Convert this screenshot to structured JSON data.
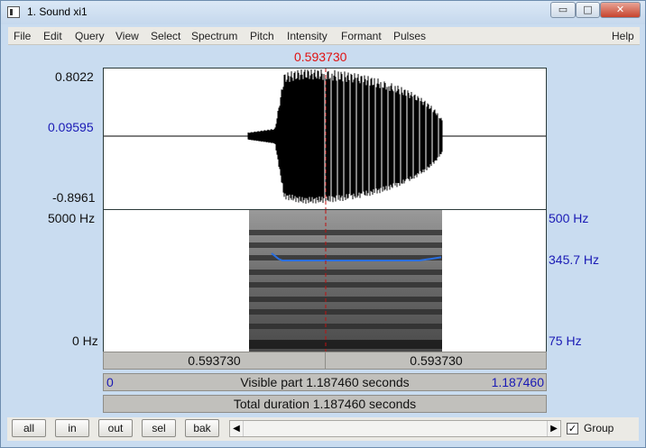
{
  "window": {
    "title": "1. Sound xi1",
    "minimize_glyph": "▭",
    "maximize_glyph": "□",
    "close_glyph": "✕"
  },
  "menu": [
    "File",
    "Edit",
    "Query",
    "View",
    "Select",
    "Spectrum",
    "Pitch",
    "Intensity",
    "Formant",
    "Pulses"
  ],
  "help_label": "Help",
  "cursor": {
    "time_label": "0.593730",
    "color": "#e01010"
  },
  "waveform": {
    "max_label": "0.8022",
    "mid_label": "0.09595",
    "min_label": "-0.8961"
  },
  "spectrogram": {
    "freq_top_label": "5000 Hz",
    "freq_bottom_label": "0 Hz",
    "pitch_top_label": "500 Hz",
    "pitch_value_label": "345.7 Hz",
    "pitch_bottom_label": "75 Hz",
    "pitch_color": "#2a6fe0"
  },
  "selection": {
    "left": "0.593730",
    "right": "0.593730"
  },
  "visible": {
    "start": "0",
    "text": "Visible part 1.187460 seconds",
    "end": "1.187460"
  },
  "total": {
    "text": "Total duration 1.187460 seconds"
  },
  "buttons": [
    "all",
    "in",
    "out",
    "sel",
    "bak"
  ],
  "scroll": {
    "left_glyph": "◀",
    "right_glyph": "▶"
  },
  "group": {
    "checked": true,
    "label": "Group",
    "check_glyph": "✓"
  }
}
